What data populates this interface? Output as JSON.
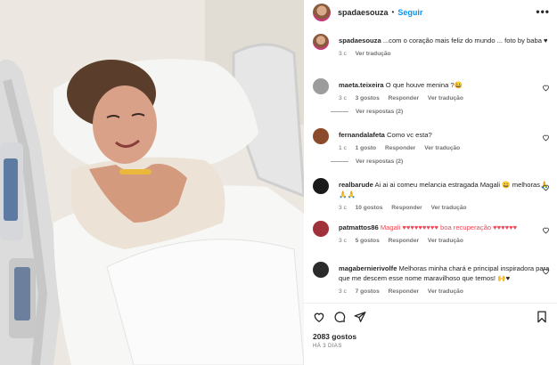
{
  "post": {
    "username": "spadaesouza",
    "separator": "•",
    "follow_label": "Seguir",
    "more_icon": "more-options-icon",
    "caption": {
      "username": "spadaesouza",
      "text": "...com o coração mais feliz do mundo ... foto by baba ♥",
      "time": "3 c",
      "translate": "Ver tradução"
    }
  },
  "comments": [
    {
      "username": "maeta.teixeira",
      "text": "O que houve menina ?😀",
      "time": "3 c",
      "likes": "3 gostos",
      "reply": "Responder",
      "translate": "Ver tradução",
      "replies_label": "Ver respostas (2)",
      "avatar_color": "#9c9c9c"
    },
    {
      "username": "fernandalafeta",
      "text": "Como vc esta?",
      "time": "1 c",
      "likes": "1 gosto",
      "reply": "Responder",
      "translate": "Ver tradução",
      "replies_label": "Ver respostas (2)",
      "avatar_color": "#8b4a2b"
    },
    {
      "username": "realbarude",
      "text": "Ai ai ai comeu melancia estragada Magali 😀 melhoras🙏🙏🙏",
      "time": "3 c",
      "likes": "10 gostos",
      "reply": "Responder",
      "translate": "Ver tradução",
      "avatar_color": "#1a1a1a"
    },
    {
      "username": "patmattos86",
      "text": "Magali ♥♥♥♥♥♥♥♥♥ boa recuperação ♥♥♥♥♥♥",
      "time": "3 c",
      "likes": "5 gostos",
      "reply": "Responder",
      "translate": "Ver tradução",
      "avatar_color": "#a0303a"
    },
    {
      "username": "magabernierivolfe",
      "text": "Melhoras minha chará e principal inspiradora para que me descem esse nome maravilhoso que temos! 🙌♥",
      "time": "3 c",
      "likes": "7 gostos",
      "reply": "Responder",
      "translate": "Ver tradução",
      "avatar_color": "#2b2b2b"
    }
  ],
  "actions": {
    "likes": "2083 gostos",
    "date": "HÁ 3 DIAS",
    "icons": [
      "heart-icon",
      "comment-icon",
      "share-icon",
      "bookmark-icon"
    ]
  },
  "colors": {
    "accent": "#0095f6",
    "text": "#262626",
    "muted": "#737373",
    "heart": "#ed4956"
  }
}
